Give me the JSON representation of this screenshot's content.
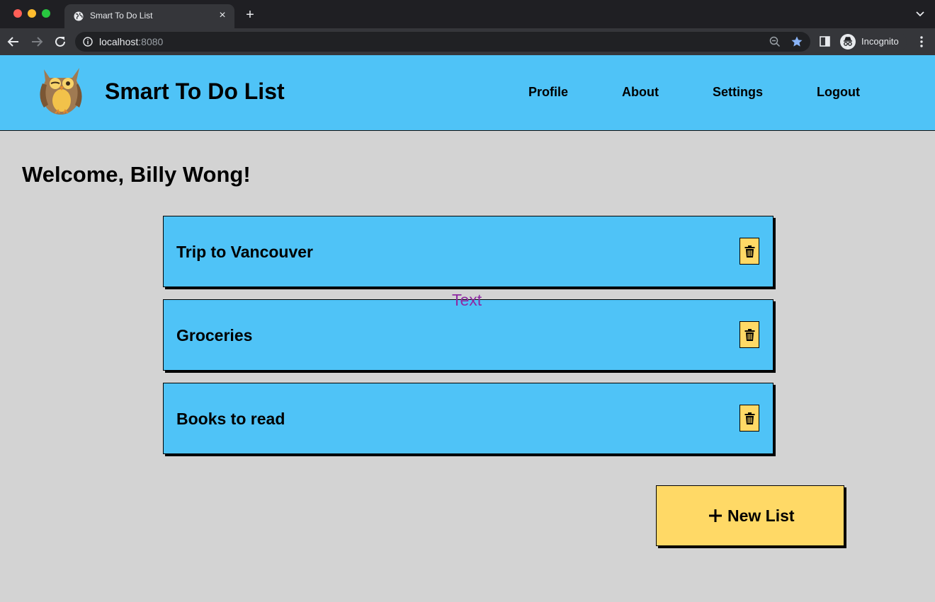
{
  "browser": {
    "tab_title": "Smart To Do List",
    "url_host": "localhost",
    "url_port": ":8080",
    "profile_label": "Incognito"
  },
  "header": {
    "app_title": "Smart To Do List",
    "logo_icon": "owl-logo",
    "nav": {
      "profile": "Profile",
      "about": "About",
      "settings": "Settings",
      "logout": "Logout"
    }
  },
  "main": {
    "welcome": "Welcome, Billy Wong!",
    "lists": [
      {
        "title": "Trip to Vancouver",
        "delete_icon": "trash-icon"
      },
      {
        "title": "Groceries",
        "delete_icon": "trash-icon"
      },
      {
        "title": "Books to read",
        "delete_icon": "trash-icon"
      }
    ],
    "floating_text": "Text",
    "new_list_label": "New List"
  },
  "colors": {
    "header_bg": "#4fc3f7",
    "card_bg": "#4fc3f7",
    "button_bg": "#ffd966",
    "page_bg": "#d3d3d3",
    "floating_text": "#8e2aa3"
  }
}
